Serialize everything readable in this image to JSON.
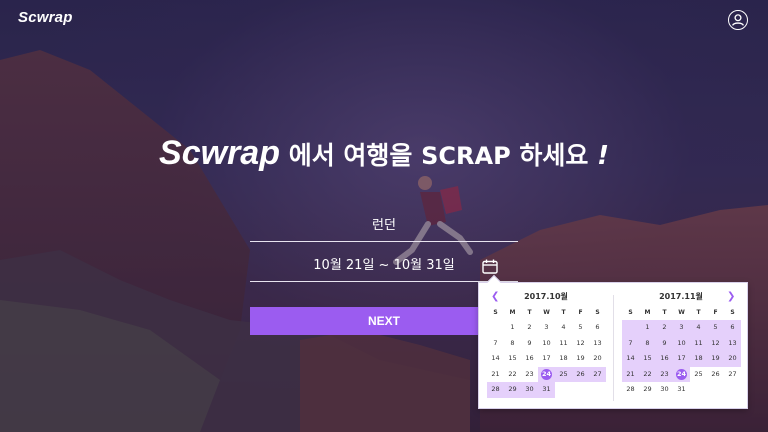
{
  "header": {
    "logo": "Scwrap",
    "user_icon": "user-circle-icon"
  },
  "hero": {
    "brand": "Scwrap",
    "text_pre": " 에서 여행을 ",
    "keyword": "SCRAP",
    "text_post": " 하세요 ",
    "bang": "!"
  },
  "form": {
    "city_value": "런던",
    "date_value": "10월 21일 ~ 10월 31일",
    "calendar_icon": "calendar-icon",
    "next_label": "NEXT"
  },
  "datepicker": {
    "prev_icon": "chevron-left-icon",
    "next_icon": "chevron-right-icon",
    "weekdays": [
      "S",
      "M",
      "T",
      "W",
      "T",
      "F",
      "S"
    ],
    "accent": "#9b5cf0",
    "range_color": "#e5d0fb",
    "months": [
      {
        "title": "2017.10월",
        "weeks": [
          [
            "",
            "",
            "1",
            "2",
            "3",
            "4",
            "5",
            "6"
          ],
          [
            "7",
            "8",
            "9",
            "10",
            "11",
            "12",
            "13"
          ],
          [
            "14",
            "15",
            "16",
            "17",
            "18",
            "19",
            "20"
          ],
          [
            "21",
            "22",
            "23",
            "24",
            "25",
            "26",
            "27"
          ],
          [
            "28",
            "29",
            "30",
            "31",
            "",
            "",
            ""
          ]
        ]
      },
      {
        "title": "2017.11월",
        "weeks": [
          [
            "",
            "",
            "1",
            "2",
            "3",
            "4",
            "5",
            "6"
          ],
          [
            "7",
            "8",
            "9",
            "10",
            "11",
            "12",
            "13"
          ],
          [
            "14",
            "15",
            "16",
            "17",
            "18",
            "19",
            "20"
          ],
          [
            "21",
            "22",
            "23",
            "24",
            "25",
            "26",
            "27"
          ],
          [
            "28",
            "29",
            "30",
            "31",
            "",
            "",
            ""
          ]
        ]
      }
    ]
  }
}
